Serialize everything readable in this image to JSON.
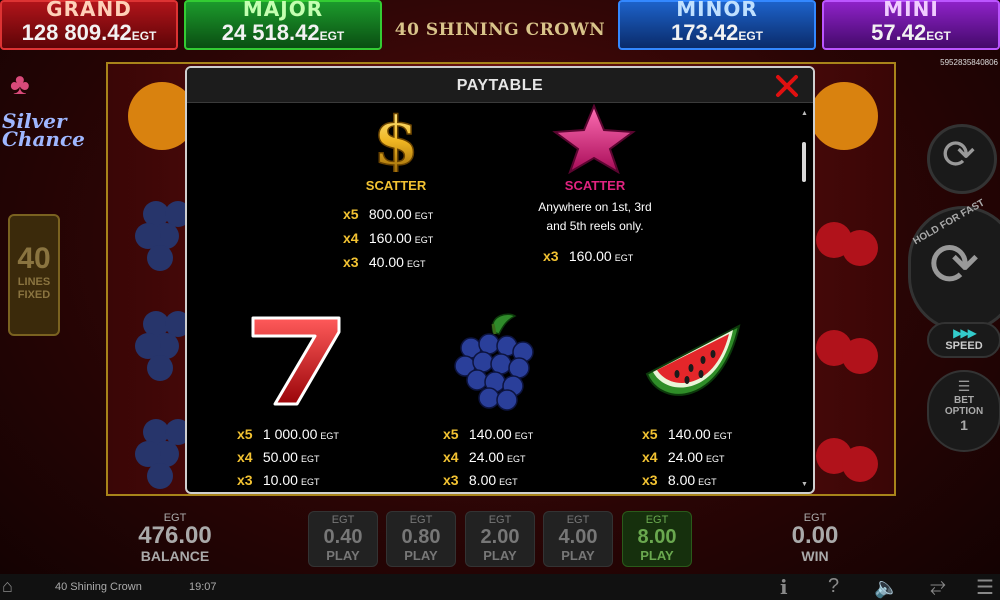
{
  "jackpots": {
    "grand": {
      "name": "GRAND",
      "value": "128 809.42",
      "currency": "EGT"
    },
    "major": {
      "name": "MAJOR",
      "value": "24 518.42",
      "currency": "EGT"
    },
    "minor": {
      "name": "MINOR",
      "value": "173.42",
      "currency": "EGT"
    },
    "mini": {
      "name": "MINI",
      "value": "57.42",
      "currency": "EGT"
    }
  },
  "game_title": "40 SHINING CROWN",
  "ticket_id": "5952835840806",
  "left_panel": {
    "logo_text_line1": "Silver",
    "logo_text_line2": "Chance",
    "lines_number": "40",
    "lines_label1": "LINES",
    "lines_label2": "FIXED"
  },
  "right_panel": {
    "hold_text": "HOLD FOR FAST",
    "speed_label": "SPEED",
    "bet_option_label1": "BET",
    "bet_option_label2": "OPTION",
    "bet_option_value": "1"
  },
  "modal": {
    "title": "PAYTABLE",
    "symbols": {
      "dollar": {
        "name": "SCATTER",
        "name_color": "#f2c232",
        "pays": [
          {
            "mult": "x5",
            "amount": "800.00",
            "currency": "EGT"
          },
          {
            "mult": "x4",
            "amount": "160.00",
            "currency": "EGT"
          },
          {
            "mult": "x3",
            "amount": "40.00",
            "currency": "EGT"
          }
        ]
      },
      "star": {
        "name": "SCATTER",
        "name_color": "#e0237f",
        "note_line1": "Anywhere on 1st, 3rd",
        "note_line2": "and 5th reels only.",
        "pays": [
          {
            "mult": "x3",
            "amount": "160.00",
            "currency": "EGT"
          }
        ]
      },
      "seven": {
        "pays": [
          {
            "mult": "x5",
            "amount": "1 000.00",
            "currency": "EGT"
          },
          {
            "mult": "x4",
            "amount": "50.00",
            "currency": "EGT"
          },
          {
            "mult": "x3",
            "amount": "10.00",
            "currency": "EGT"
          }
        ]
      },
      "grapes": {
        "pays": [
          {
            "mult": "x5",
            "amount": "140.00",
            "currency": "EGT"
          },
          {
            "mult": "x4",
            "amount": "24.00",
            "currency": "EGT"
          },
          {
            "mult": "x3",
            "amount": "8.00",
            "currency": "EGT"
          }
        ]
      },
      "watermelon": {
        "pays": [
          {
            "mult": "x5",
            "amount": "140.00",
            "currency": "EGT"
          },
          {
            "mult": "x4",
            "amount": "24.00",
            "currency": "EGT"
          },
          {
            "mult": "x3",
            "amount": "8.00",
            "currency": "EGT"
          }
        ]
      }
    }
  },
  "bottom": {
    "balance": {
      "currency": "EGT",
      "value": "476.00",
      "label": "BALANCE"
    },
    "win": {
      "currency": "EGT",
      "value": "0.00",
      "label": "WIN"
    },
    "bets": [
      {
        "currency": "EGT",
        "value": "0.40",
        "label": "PLAY",
        "active": false
      },
      {
        "currency": "EGT",
        "value": "0.80",
        "label": "PLAY",
        "active": false
      },
      {
        "currency": "EGT",
        "value": "2.00",
        "label": "PLAY",
        "active": false
      },
      {
        "currency": "EGT",
        "value": "4.00",
        "label": "PLAY",
        "active": false
      },
      {
        "currency": "EGT",
        "value": "8.00",
        "label": "PLAY",
        "active": true
      }
    ]
  },
  "statusbar": {
    "game_name": "40 Shining Crown",
    "clock": "19:07"
  },
  "colors": {
    "accent_gold": "#f2c232",
    "star_pink": "#e0237f",
    "close_red": "#e01010",
    "active_bet_green": "#6aa84f"
  }
}
